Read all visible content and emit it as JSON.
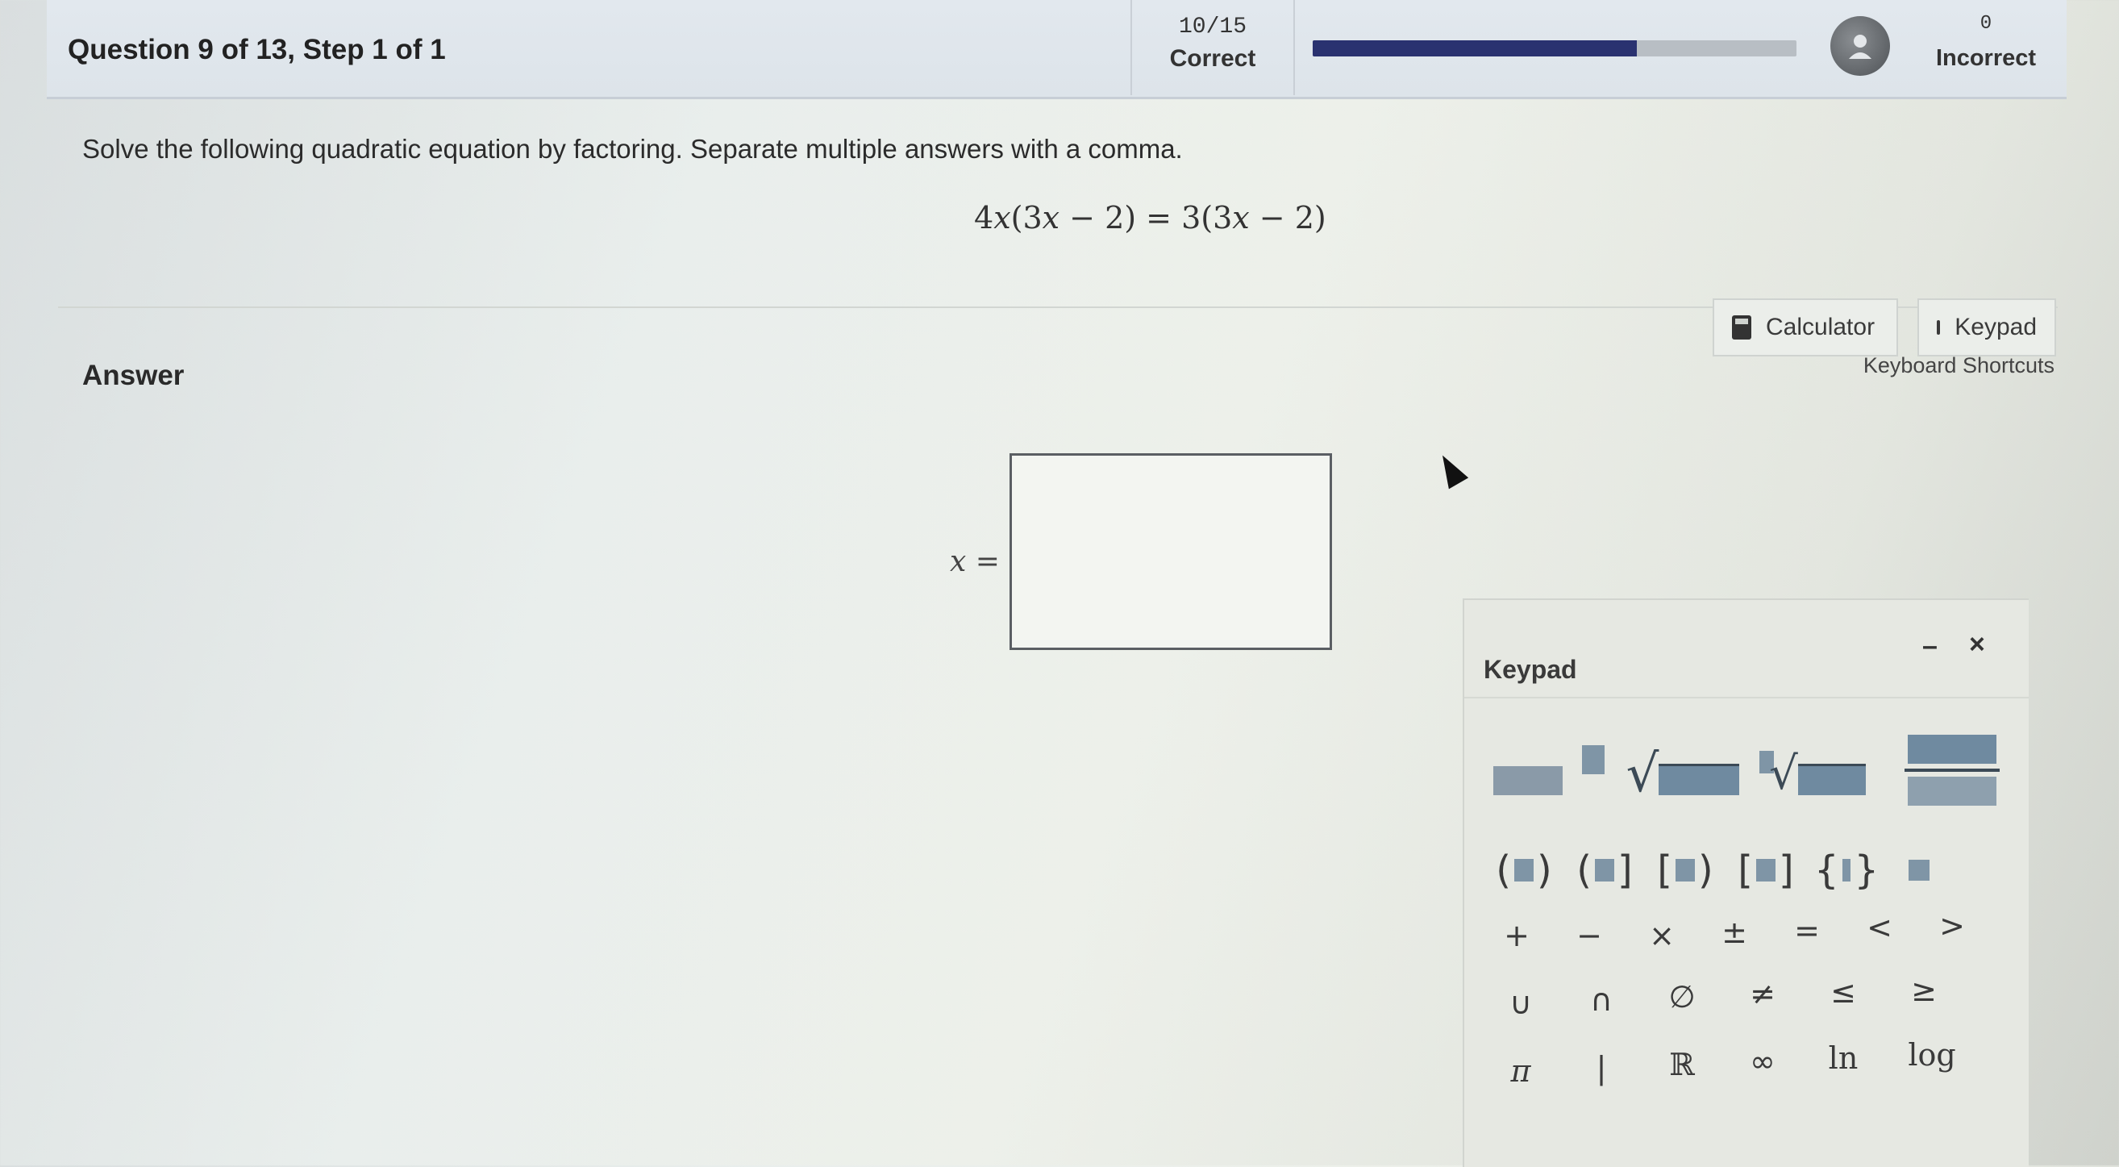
{
  "header": {
    "question_title": "Question 9 of 13,  Step 1 of 1",
    "score_count": "10/15",
    "score_label": "Correct",
    "progress_percent": 67,
    "avatar_icon": "user-avatar-icon",
    "incorrect_count": "0",
    "incorrect_label": "Incorrect"
  },
  "question": {
    "prompt": "Solve the following quadratic equation by factoring. Separate multiple answers with a comma.",
    "equation": {
      "coef_left": "4",
      "var": "x",
      "paren_left": "(3",
      "var2": "x",
      "rest_left": " − 2) = 3(3",
      "var3": "x",
      "rest_right": " − 2)"
    }
  },
  "answer": {
    "label": "Answer",
    "variable": "x",
    "equals": " =",
    "input_value": ""
  },
  "tools": {
    "calculator_label": "Calculator",
    "keypad_label": "Keypad",
    "shortcuts_label": "Keyboard Shortcuts"
  },
  "keypad": {
    "title": "Keypad",
    "minimize": "–",
    "close": "×",
    "row_brackets": {
      "paren_open": "(",
      "paren_close": ")",
      "mixed1_open": "(",
      "mixed1_close": "]",
      "mixed2_open": "[",
      "mixed2_close": ")",
      "square_open": "[",
      "square_close": "]",
      "brace_open": "{",
      "brace_close": "}"
    },
    "row_ops": [
      "+",
      "−",
      "×",
      "±",
      "=",
      "<",
      ">"
    ],
    "row_sets": [
      "∪",
      "∩",
      "∅",
      "≠",
      "≤",
      "≥"
    ],
    "row_misc": [
      "π",
      "|",
      "ℝ",
      "∞",
      "ln",
      "log"
    ]
  }
}
